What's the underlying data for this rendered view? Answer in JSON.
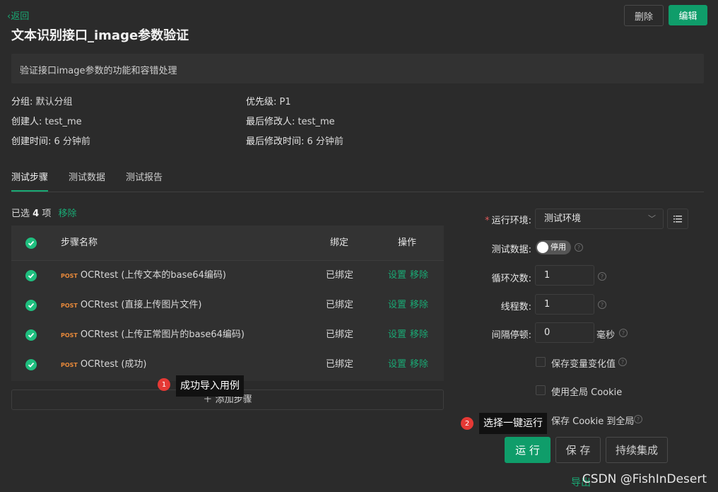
{
  "header": {
    "back": "返回",
    "title": "文本识别接口_image参数验证",
    "delete_label": "删除",
    "edit_label": "编辑"
  },
  "description": "验证接口image参数的功能和容错处理",
  "meta": {
    "group_label": "分组:",
    "group_value": "默认分组",
    "priority_label": "优先级:",
    "priority_value": "P1",
    "creator_label": "创建人:",
    "creator_value": "test_me",
    "modifier_label": "最后修改人:",
    "modifier_value": "test_me",
    "created_label": "创建时间:",
    "created_value": "6 分钟前",
    "modified_label": "最后修改时间:",
    "modified_value": "6 分钟前"
  },
  "tabs": [
    "测试步骤",
    "测试数据",
    "测试报告"
  ],
  "selection": {
    "prefix": "已选",
    "count": "4",
    "suffix": "项",
    "remove": "移除"
  },
  "table": {
    "headers": {
      "name": "步骤名称",
      "bind": "绑定",
      "ops": "操作"
    },
    "method": "POST",
    "rows": [
      {
        "name": "OCRtest (上传文本的base64编码)",
        "bind": "已绑定"
      },
      {
        "name": "OCRtest (直接上传图片文件)",
        "bind": "已绑定"
      },
      {
        "name": "OCRtest (上传正常图片的base64编码)",
        "bind": "已绑定"
      },
      {
        "name": "OCRtest (成功)",
        "bind": "已绑定"
      }
    ],
    "op_set": "设置",
    "op_remove": "移除"
  },
  "add_step": "添加步骤",
  "tooltips": [
    {
      "num": "1",
      "text": "成功导入用例"
    },
    {
      "num": "2",
      "text": "选择一键运行"
    }
  ],
  "form": {
    "env_label": "运行环境:",
    "env_value": "测试环境",
    "data_label": "测试数据:",
    "data_toggle": "停用",
    "loop_label": "循环次数:",
    "loop_value": "1",
    "threads_label": "线程数:",
    "threads_value": "1",
    "interval_label": "间隔停顿:",
    "interval_value": "0",
    "interval_unit": "毫秒",
    "opt_save_var": "保存变量变化值",
    "opt_global_cookie": "使用全局 Cookie",
    "opt_save_cookie": "保存 Cookie 到全局"
  },
  "actions": {
    "run": "运 行",
    "save": "保 存",
    "ci": "持续集成",
    "export": "导出"
  },
  "watermark": "CSDN @FishInDesert",
  "colors": {
    "accent": "#19a974",
    "bg": "#2b2b2b",
    "post": "#e8893a"
  }
}
